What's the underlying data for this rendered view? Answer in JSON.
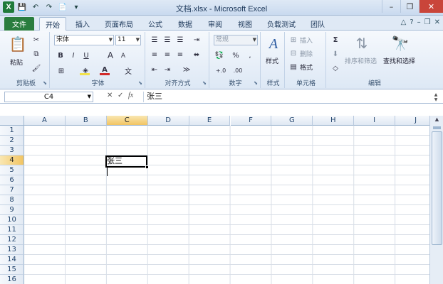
{
  "window": {
    "title": "文档.xlsx - Microsoft Excel",
    "logo": "X",
    "minimize": "–",
    "restore": "❐",
    "close": "✕"
  },
  "qat": {
    "save": "💾",
    "undo": "↶",
    "redo": "↷",
    "new": "📄",
    "more": "▾"
  },
  "tabs": [
    {
      "label": "文件"
    },
    {
      "label": "开始"
    },
    {
      "label": "插入"
    },
    {
      "label": "页面布局"
    },
    {
      "label": "公式"
    },
    {
      "label": "数据"
    },
    {
      "label": "审阅"
    },
    {
      "label": "视图"
    },
    {
      "label": "负载测试"
    },
    {
      "label": "团队"
    }
  ],
  "ribbon": {
    "clipboard": {
      "label": "剪贴板",
      "paste": "粘贴",
      "paste_icon": "📋",
      "cut_icon": "✂",
      "copy_icon": "⧉",
      "painter_icon": "🖌"
    },
    "font": {
      "label": "字体",
      "name": "宋体",
      "size": "11",
      "bold": "B",
      "italic": "I",
      "underline": "U",
      "grow": "A",
      "shrink": "A",
      "font_color": "A",
      "fill": "◈",
      "border": "⊞",
      "phonetic": "文"
    },
    "alignment": {
      "label": "对齐方式",
      "wrap": "⇥",
      "merge": "⬌",
      "orient": "≫"
    },
    "number": {
      "label": "数字",
      "format": "常规",
      "currency": "💱",
      "percent": "%",
      "comma": ",",
      "inc_dec": "+.0",
      "dec_dec": ".00"
    },
    "styles": {
      "label": "样式",
      "icon": "A",
      "text": "样式"
    },
    "cells": {
      "label": "单元格",
      "insert": "插入",
      "delete": "删除",
      "format": "格式"
    },
    "editing": {
      "label": "编辑",
      "sum": "Σ",
      "fill": "⬇",
      "clear": "◇",
      "sort": "排序和筛选",
      "find": "查找和选择"
    },
    "colors": {
      "font_color_bar": "#d22a2a",
      "fill_bar": "#f2e24b"
    }
  },
  "formula_bar": {
    "name_box": "C4",
    "cancel": "✕",
    "enter": "✓",
    "fx": "fx",
    "content": "张三"
  },
  "sheet": {
    "columns": [
      "A",
      "B",
      "C",
      "D",
      "E",
      "F",
      "G",
      "H",
      "I",
      "J"
    ],
    "rows": [
      "1",
      "2",
      "3",
      "4",
      "5",
      "6",
      "7",
      "8",
      "9",
      "10",
      "11",
      "12",
      "13",
      "14",
      "15",
      "16"
    ],
    "active_col": "C",
    "active_row": "4",
    "cells": {
      "C4": "张三"
    }
  }
}
